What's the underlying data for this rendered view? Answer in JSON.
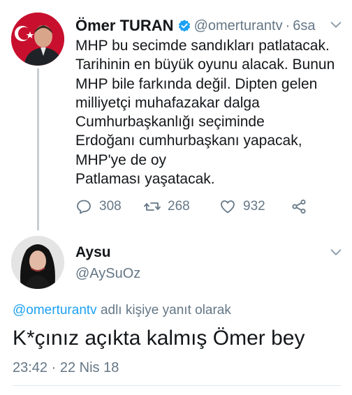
{
  "original_tweet": {
    "author": {
      "name": "Ömer TURAN",
      "handle": "@omerturantv",
      "verified": true
    },
    "separator": "·",
    "time": "6sa",
    "text_lines": [
      "MHP bu secimde sandıkları patlatacak.",
      "Tarihinin en büyük oyunu alacak. Bunun",
      "MHP bile farkında değil. Dipten gelen",
      "milliyetçi muhafazakar dalga",
      "Cumhurbaşkanlığı seçiminde",
      "Erdoğanı cumhurbaşkanı yapacak,",
      "MHP'ye de oy",
      "Patlaması yaşatacak."
    ],
    "actions": {
      "replies": "308",
      "retweets": "268",
      "likes": "932"
    }
  },
  "reply_tweet": {
    "author": {
      "name": "Aysu",
      "handle": "@AySuOz"
    },
    "replying_to_handle": "@omerturantv",
    "replying_to_suffix": " adlı kişiye yanıt olarak",
    "text": "K*çınız açıkta kalmış Ömer bey",
    "timestamp": "23:42 · 22 Nis 18"
  },
  "colors": {
    "accent": "#1da1f2",
    "muted": "#657786",
    "text": "#14171a"
  },
  "icons": [
    "chevron-down-icon",
    "verified-badge-icon",
    "reply-icon",
    "retweet-icon",
    "like-icon",
    "share-icon"
  ]
}
